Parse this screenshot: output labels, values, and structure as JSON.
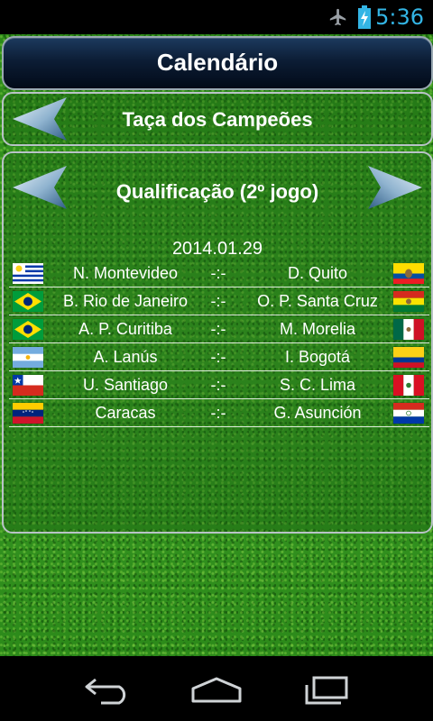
{
  "status": {
    "time": "5:36"
  },
  "header": {
    "title": "Calendário"
  },
  "cup": {
    "name": "Taça dos Campeões"
  },
  "round": {
    "name": "Qualificação (2º jogo)",
    "date": "2014.01.29"
  },
  "matches": [
    {
      "home": "N. Montevideo",
      "score": "-:-",
      "away": "D. Quito",
      "home_flag": "uruguay",
      "away_flag": "ecuador"
    },
    {
      "home": "B. Rio de Janeiro",
      "score": "-:-",
      "away": "O. P. Santa Cruz",
      "home_flag": "brazil",
      "away_flag": "bolivia"
    },
    {
      "home": "A. P. Curitiba",
      "score": "-:-",
      "away": "M. Morelia",
      "home_flag": "brazil",
      "away_flag": "mexico"
    },
    {
      "home": "A. Lanús",
      "score": "-:-",
      "away": "I. Bogotá",
      "home_flag": "argentina",
      "away_flag": "colombia"
    },
    {
      "home": "U. Santiago",
      "score": "-:-",
      "away": "S. C. Lima",
      "home_flag": "chile",
      "away_flag": "peru"
    },
    {
      "home": "Caracas",
      "score": "-:-",
      "away": "G. Asunción",
      "home_flag": "venezuela",
      "away_flag": "paraguay"
    }
  ],
  "icons": {
    "status": [
      "airplane-mode-icon",
      "battery-charging-icon"
    ],
    "nav": [
      "back-icon",
      "home-icon",
      "recent-apps-icon"
    ],
    "arrows": [
      "arrow-left-icon",
      "arrow-right-icon"
    ]
  },
  "colors": {
    "accent": "#33b5e5",
    "title_bg": "#0c1d35",
    "grass": "#2f8a1c"
  }
}
